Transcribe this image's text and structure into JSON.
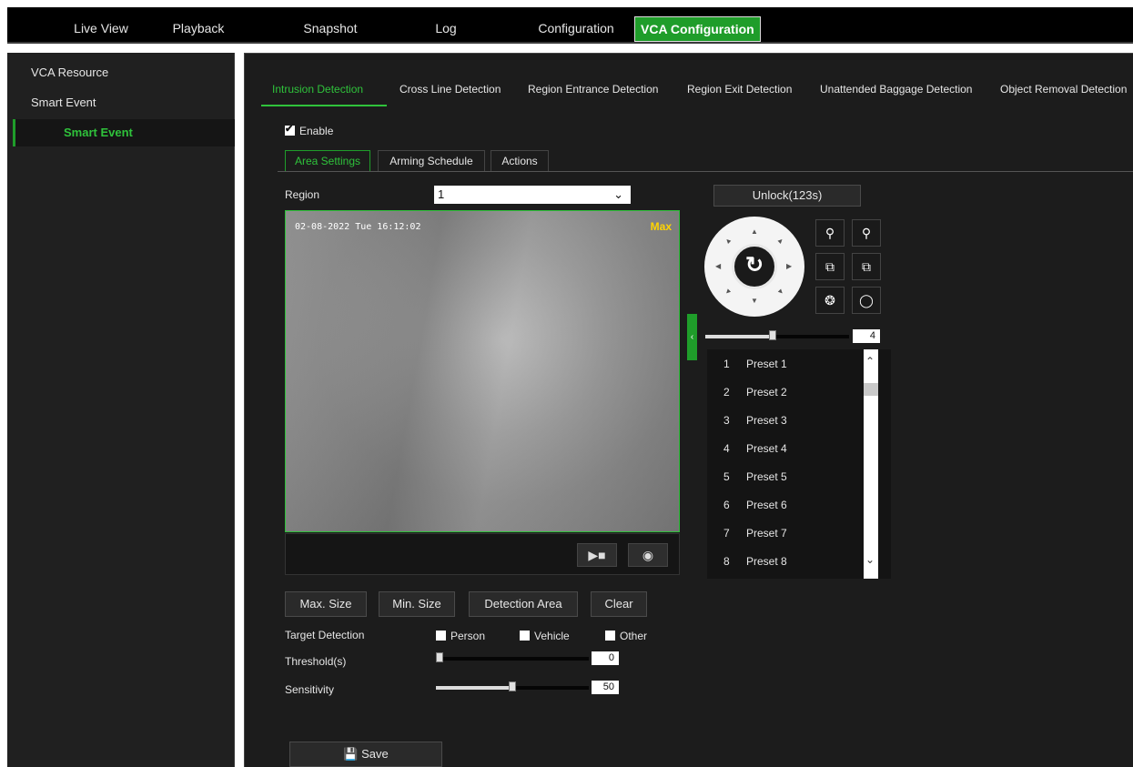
{
  "nav": {
    "tabs": [
      "Live View",
      "Playback",
      "Snapshot",
      "Log",
      "Configuration",
      "VCA Configuration"
    ],
    "active": "VCA Configuration"
  },
  "sidebar": {
    "items": [
      "VCA Resource",
      "Smart Event"
    ],
    "selected": "Smart Event"
  },
  "detection_tabs": [
    "Intrusion Detection",
    "Cross Line Detection",
    "Region Entrance Detection",
    "Region Exit Detection",
    "Unattended Baggage Detection",
    "Object Removal Detection"
  ],
  "enable": {
    "label": "Enable",
    "checked": true
  },
  "sub_tabs": [
    "Area Settings",
    "Arming Schedule",
    "Actions"
  ],
  "region": {
    "label": "Region",
    "value": "1"
  },
  "video": {
    "osd_time": "02-08-2022 Tue 16:12:02",
    "max_label": "Max"
  },
  "area_buttons": [
    "Max. Size",
    "Min. Size",
    "Detection Area",
    "Clear"
  ],
  "target_detection": {
    "label": "Target Detection",
    "options": [
      {
        "label": "Person",
        "checked": false
      },
      {
        "label": "Vehicle",
        "checked": false
      },
      {
        "label": "Other",
        "checked": false
      }
    ]
  },
  "threshold": {
    "label": "Threshold(s)",
    "value": "0",
    "fraction": 0.0
  },
  "sensitivity": {
    "label": "Sensitivity",
    "value": "50",
    "fraction": 0.5
  },
  "save_label": "Save",
  "ptz": {
    "unlock_label": "Unlock(123s)",
    "speed_value": "4",
    "presets": [
      {
        "num": "1",
        "name": "Preset 1"
      },
      {
        "num": "2",
        "name": "Preset 2"
      },
      {
        "num": "3",
        "name": "Preset 3"
      },
      {
        "num": "4",
        "name": "Preset 4"
      },
      {
        "num": "5",
        "name": "Preset 5"
      },
      {
        "num": "6",
        "name": "Preset 6"
      },
      {
        "num": "7",
        "name": "Preset 7"
      },
      {
        "num": "8",
        "name": "Preset 8"
      }
    ]
  },
  "colors": {
    "accent": "#1f9d2a",
    "background": "#1c1c1c"
  }
}
